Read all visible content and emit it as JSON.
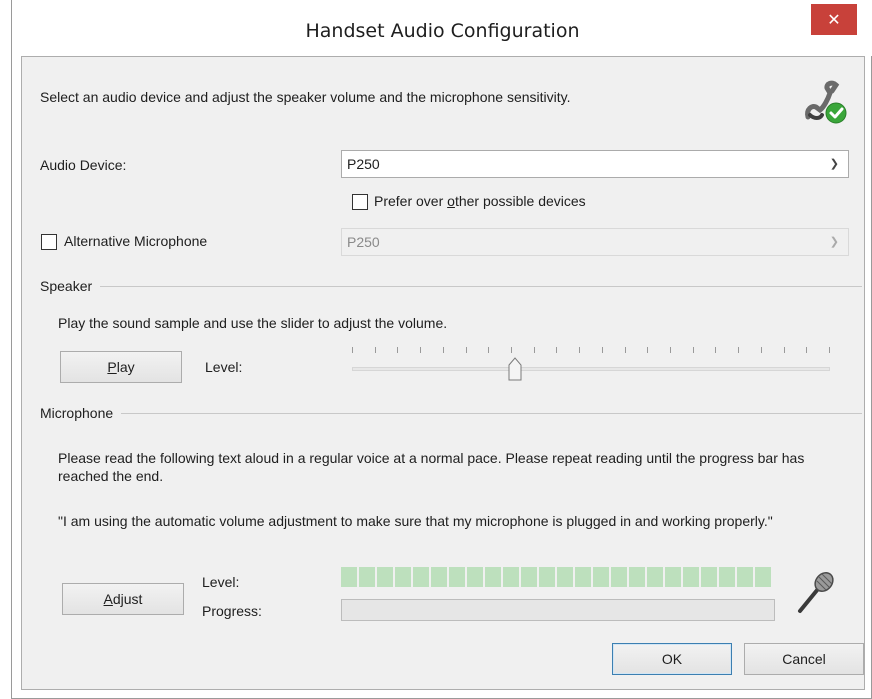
{
  "window": {
    "title": "Handset Audio Configuration",
    "close_glyph": "✕"
  },
  "instructions": "Select an audio device and adjust the speaker volume and the microphone sensitivity.",
  "header_icon": "handset-check-icon",
  "audio_device": {
    "label": "Audio Device:",
    "value": "P250"
  },
  "prefer": {
    "label_before": "Prefer over ",
    "label_accel": "o",
    "label_after": "ther possible devices",
    "checked": false
  },
  "alt_mic": {
    "label": "Alternative Microphone",
    "checked": false,
    "value": "P250",
    "enabled": false
  },
  "speaker": {
    "group_label": "Speaker",
    "instruction": "Play the sound sample and use the slider to adjust the volume.",
    "play_accel": "P",
    "play_rest": "lay",
    "level_label": "Level:",
    "slider_level_percent": 34,
    "tick_count": 22
  },
  "microphone": {
    "group_label": "Microphone",
    "instruction": "Please read the following text aloud in a regular voice at a normal pace. Please repeat reading until the progress bar has reached the end.",
    "quote": "\"I am using the automatic volume adjustment to make sure that my microphone is plugged in and working properly.\"",
    "adjust_accel": "A",
    "adjust_rest": "djust",
    "level_label": "Level:",
    "progress_label": "Progress:",
    "level_segments": 24,
    "progress_percent": 0,
    "icon": "microphone-icon"
  },
  "buttons": {
    "ok": "OK",
    "cancel": "Cancel"
  },
  "colors": {
    "close_bg": "#c8413a",
    "level_segment": "#bde0bd",
    "focus_border": "#3c7fb1"
  }
}
